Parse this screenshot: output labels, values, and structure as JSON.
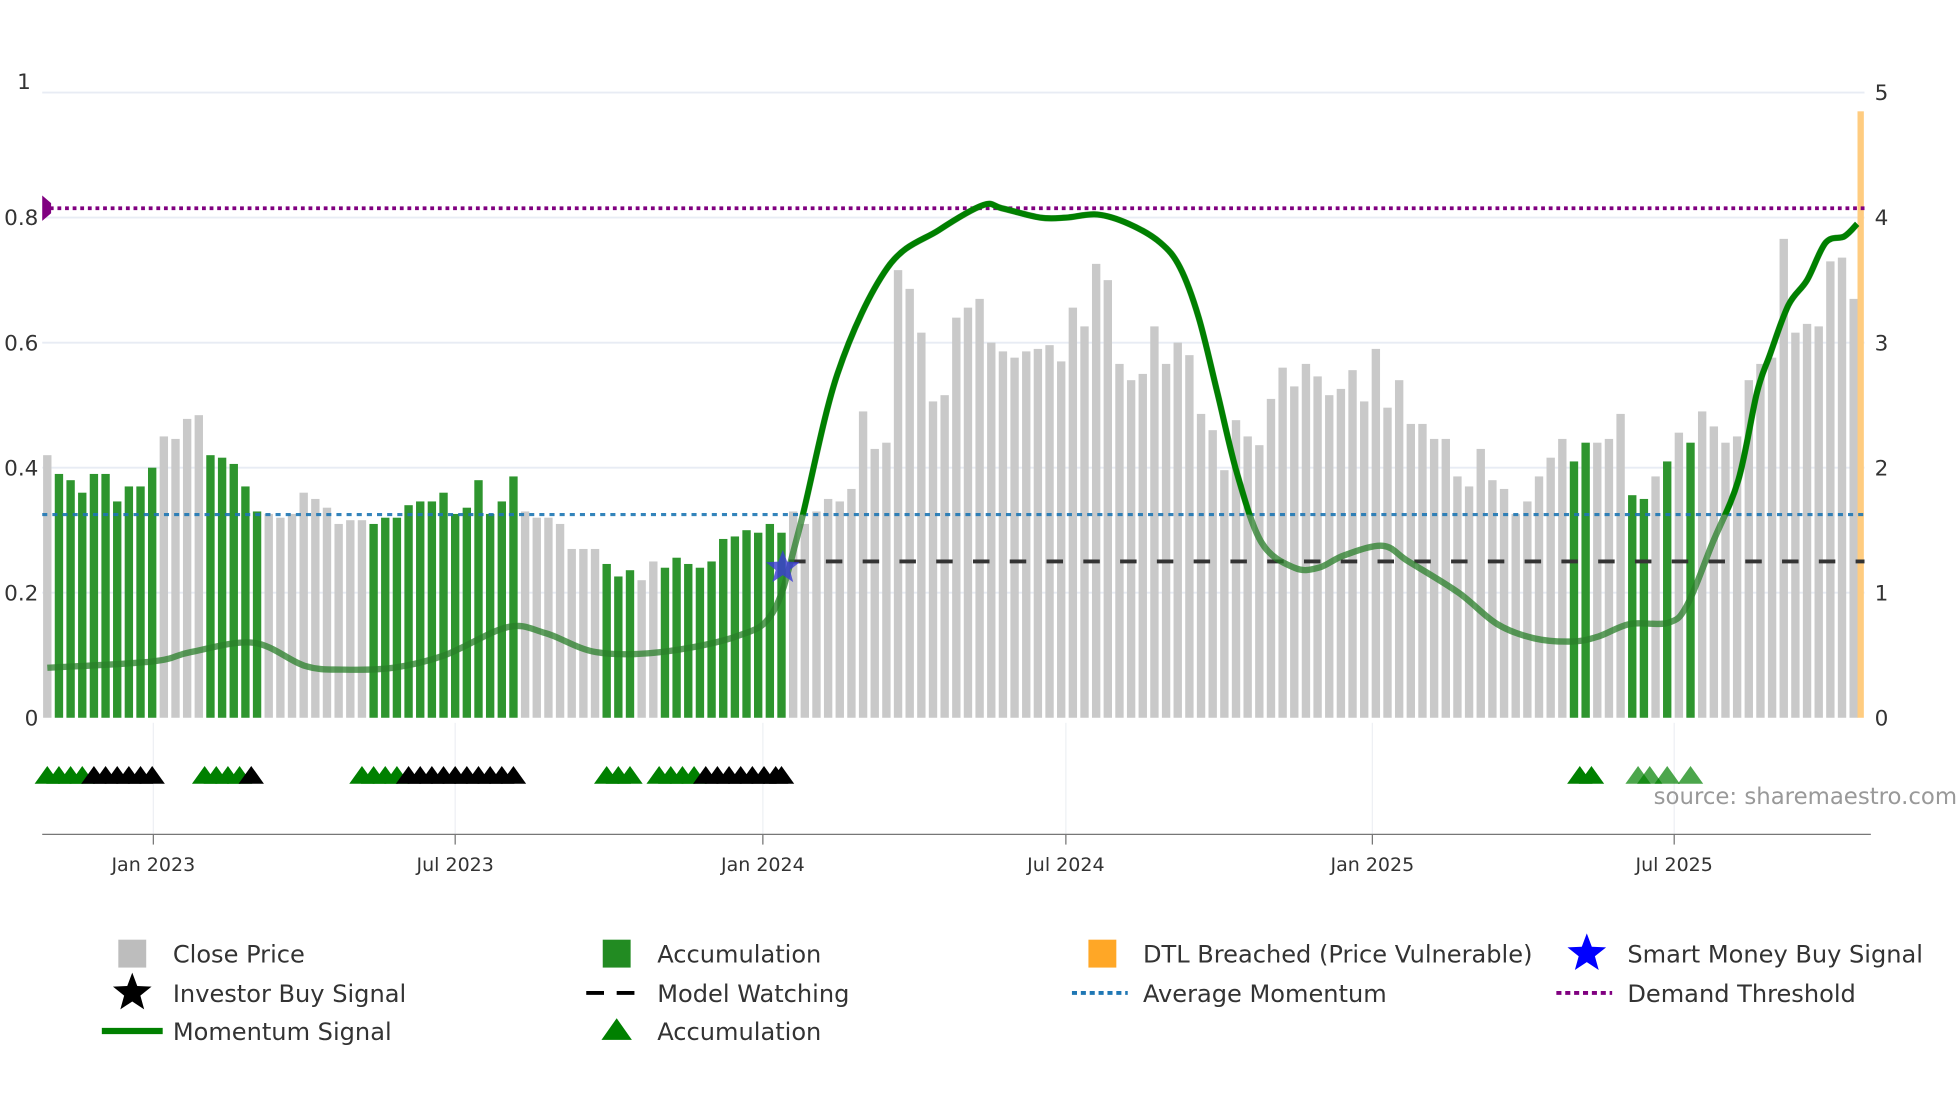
{
  "chart_data": {
    "type": "bar",
    "title": "",
    "source": "source: sharemaestro.com",
    "left_axis": {
      "range": [
        0,
        1
      ],
      "ticks": [
        "0",
        "0.2",
        "0.4",
        "0.6",
        "0.8",
        "1"
      ]
    },
    "right_axis": {
      "range": [
        0,
        5
      ],
      "ticks": [
        "0",
        "1",
        "2",
        "3",
        "4",
        "5"
      ]
    },
    "x_ticks": [
      {
        "label": "Jan 2023",
        "week": 9.1
      },
      {
        "label": "Jul 2023",
        "week": 35
      },
      {
        "label": "Jan 2024",
        "week": 61.4
      },
      {
        "label": "Jul 2024",
        "week": 87.4
      },
      {
        "label": "Jan 2025",
        "week": 113.7
      },
      {
        "label": "Jul 2025",
        "week": 139.6
      }
    ],
    "close_price": [
      2.1,
      1.95,
      1.9,
      1.8,
      1.95,
      1.95,
      1.73,
      1.85,
      1.85,
      2.0,
      2.25,
      2.23,
      2.39,
      2.42,
      2.1,
      2.08,
      2.03,
      1.85,
      1.65,
      1.63,
      1.6,
      1.63,
      1.8,
      1.75,
      1.68,
      1.55,
      1.58,
      1.58,
      1.55,
      1.6,
      1.6,
      1.7,
      1.73,
      1.73,
      1.8,
      1.63,
      1.68,
      1.9,
      1.63,
      1.73,
      1.93,
      1.65,
      1.6,
      1.6,
      1.55,
      1.35,
      1.35,
      1.35,
      1.23,
      1.13,
      1.18,
      1.1,
      1.25,
      1.2,
      1.28,
      1.23,
      1.2,
      1.25,
      1.43,
      1.45,
      1.5,
      1.48,
      1.55,
      1.48,
      1.65,
      1.55,
      1.65,
      1.75,
      1.73,
      1.83,
      2.45,
      2.15,
      2.2,
      3.58,
      3.43,
      3.08,
      2.53,
      2.58,
      3.2,
      3.28,
      3.35,
      3.0,
      2.93,
      2.88,
      2.93,
      2.95,
      2.98,
      2.85,
      3.28,
      3.13,
      3.63,
      3.5,
      2.83,
      2.7,
      2.75,
      3.13,
      2.83,
      3.0,
      2.9,
      2.43,
      2.3,
      1.98,
      2.38,
      2.25,
      2.18,
      2.55,
      2.8,
      2.65,
      2.83,
      2.73,
      2.58,
      2.63,
      2.78,
      2.53,
      2.95,
      2.48,
      2.7,
      2.35,
      2.35,
      2.23,
      2.23,
      1.93,
      1.85,
      2.15,
      1.9,
      1.83,
      1.63,
      1.73,
      1.93,
      2.08,
      2.23,
      2.05,
      2.2,
      2.2,
      2.23,
      2.43,
      1.78,
      1.75,
      1.93,
      2.05,
      2.28,
      2.2,
      2.45,
      2.33,
      2.2,
      2.25,
      2.7,
      2.83,
      2.88,
      3.83,
      3.08,
      3.15,
      3.13,
      3.65,
      3.68,
      3.35
    ],
    "accumulation_weeks": [
      1,
      2,
      3,
      4,
      5,
      6,
      7,
      8,
      9,
      14,
      15,
      16,
      17,
      18,
      28,
      29,
      30,
      31,
      32,
      33,
      34,
      35,
      36,
      37,
      38,
      39,
      40,
      48,
      49,
      50,
      53,
      54,
      55,
      56,
      57,
      58,
      59,
      60,
      61,
      62,
      63,
      131,
      132,
      136,
      137,
      139,
      141
    ],
    "dtl_breached": {
      "week": 155.6,
      "value": 4.85
    },
    "momentum_signal": [
      [
        0,
        0.08
      ],
      [
        9,
        0.09
      ],
      [
        12.3,
        0.105
      ],
      [
        17.7,
        0.12
      ],
      [
        22.1,
        0.083
      ],
      [
        25.4,
        0.077
      ],
      [
        29.7,
        0.08
      ],
      [
        34.1,
        0.1
      ],
      [
        39.5,
        0.145
      ],
      [
        42.8,
        0.135
      ],
      [
        47.1,
        0.105
      ],
      [
        52.6,
        0.105
      ],
      [
        59.1,
        0.13
      ],
      [
        62.3,
        0.17
      ],
      [
        64.5,
        0.3
      ],
      [
        67.8,
        0.55
      ],
      [
        72.1,
        0.72
      ],
      [
        76.5,
        0.78
      ],
      [
        80.3,
        0.82
      ],
      [
        81.9,
        0.815
      ],
      [
        85.2,
        0.8
      ],
      [
        87.4,
        0.8
      ],
      [
        90.1,
        0.805
      ],
      [
        92.8,
        0.79
      ],
      [
        95.5,
        0.76
      ],
      [
        97.2,
        0.72
      ],
      [
        98.8,
        0.64
      ],
      [
        100.4,
        0.52
      ],
      [
        102.1,
        0.39
      ],
      [
        104.2,
        0.28
      ],
      [
        107,
        0.24
      ],
      [
        109.1,
        0.24
      ],
      [
        111.3,
        0.26
      ],
      [
        114.6,
        0.275
      ],
      [
        116.8,
        0.25
      ],
      [
        121.1,
        0.2
      ],
      [
        124.4,
        0.15
      ],
      [
        127.6,
        0.127
      ],
      [
        130.9,
        0.122
      ],
      [
        133.1,
        0.13
      ],
      [
        135.8,
        0.15
      ],
      [
        139.1,
        0.152
      ],
      [
        140.7,
        0.18
      ],
      [
        142.9,
        0.28
      ],
      [
        145.1,
        0.38
      ],
      [
        146.7,
        0.52
      ],
      [
        147.8,
        0.58
      ],
      [
        149.4,
        0.66
      ],
      [
        151,
        0.7
      ],
      [
        152.6,
        0.76
      ],
      [
        154.2,
        0.77
      ],
      [
        155.3,
        0.79
      ]
    ],
    "average_momentum": 0.325,
    "demand_threshold": 0.815,
    "model_watching": {
      "value": 0.25,
      "from_week": 63
    },
    "smart_money_buy_signal": {
      "week": 63,
      "value": 0.24
    },
    "signal_markers": [
      {
        "week": 0,
        "type": "accumulation"
      },
      {
        "week": 1,
        "type": "accumulation"
      },
      {
        "week": 2,
        "type": "accumulation"
      },
      {
        "week": 3,
        "type": "accumulation"
      },
      {
        "week": 4,
        "type": "investor"
      },
      {
        "week": 5,
        "type": "investor"
      },
      {
        "week": 6,
        "type": "investor"
      },
      {
        "week": 7,
        "type": "investor"
      },
      {
        "week": 8,
        "type": "investor"
      },
      {
        "week": 9,
        "type": "investor"
      },
      {
        "week": 13.5,
        "type": "accumulation"
      },
      {
        "week": 14.5,
        "type": "accumulation"
      },
      {
        "week": 15.5,
        "type": "accumulation"
      },
      {
        "week": 16.5,
        "type": "accumulation"
      },
      {
        "week": 17.5,
        "type": "investor"
      },
      {
        "week": 27,
        "type": "accumulation"
      },
      {
        "week": 28,
        "type": "accumulation"
      },
      {
        "week": 29,
        "type": "accumulation"
      },
      {
        "week": 30,
        "type": "accumulation"
      },
      {
        "week": 31,
        "type": "investor"
      },
      {
        "week": 32,
        "type": "investor"
      },
      {
        "week": 33,
        "type": "investor"
      },
      {
        "week": 34,
        "type": "investor"
      },
      {
        "week": 35,
        "type": "investor"
      },
      {
        "week": 36,
        "type": "investor"
      },
      {
        "week": 37,
        "type": "investor"
      },
      {
        "week": 38,
        "type": "investor"
      },
      {
        "week": 39,
        "type": "investor"
      },
      {
        "week": 40,
        "type": "investor"
      },
      {
        "week": 48,
        "type": "accumulation"
      },
      {
        "week": 49,
        "type": "accumulation"
      },
      {
        "week": 50,
        "type": "accumulation"
      },
      {
        "week": 52.5,
        "type": "accumulation"
      },
      {
        "week": 53.5,
        "type": "accumulation"
      },
      {
        "week": 54.5,
        "type": "accumulation"
      },
      {
        "week": 55.5,
        "type": "accumulation"
      },
      {
        "week": 56.5,
        "type": "investor"
      },
      {
        "week": 57.5,
        "type": "investor"
      },
      {
        "week": 58.5,
        "type": "investor"
      },
      {
        "week": 59.5,
        "type": "investor"
      },
      {
        "week": 60.5,
        "type": "investor"
      },
      {
        "week": 61.5,
        "type": "investor"
      },
      {
        "week": 62.5,
        "type": "investor"
      },
      {
        "week": 63,
        "type": "investor"
      },
      {
        "week": 131.5,
        "type": "accumulation"
      },
      {
        "week": 132.5,
        "type": "accumulation"
      },
      {
        "week": 136.5,
        "type": "accumulation-faded"
      },
      {
        "week": 137.5,
        "type": "accumulation-faded"
      },
      {
        "week": 139,
        "type": "accumulation-faded"
      },
      {
        "week": 141,
        "type": "accumulation-faded"
      }
    ],
    "legend": [
      {
        "label": "Close Price",
        "symbol": "square",
        "color": "#bdbdbd"
      },
      {
        "label": "Accumulation",
        "symbol": "square",
        "color": "#228b22"
      },
      {
        "label": "DTL Breached (Price Vulnerable)",
        "symbol": "square",
        "color": "#ffa726"
      },
      {
        "label": "Smart Money Buy Signal",
        "symbol": "star",
        "color": "#0000ff"
      },
      {
        "label": "Investor Buy Signal",
        "symbol": "star",
        "color": "#000000"
      },
      {
        "label": "Model Watching",
        "symbol": "dash",
        "color": "#000000"
      },
      {
        "label": "Average Momentum",
        "symbol": "dot",
        "color": "#1f77b4"
      },
      {
        "label": "Demand Threshold",
        "symbol": "dot",
        "color": "#800080"
      },
      {
        "label": "Momentum Signal",
        "symbol": "line",
        "color": "#008000"
      },
      {
        "label": "Accumulation",
        "symbol": "triangle",
        "color": "#008000"
      }
    ],
    "legend_placement": "bottom"
  }
}
